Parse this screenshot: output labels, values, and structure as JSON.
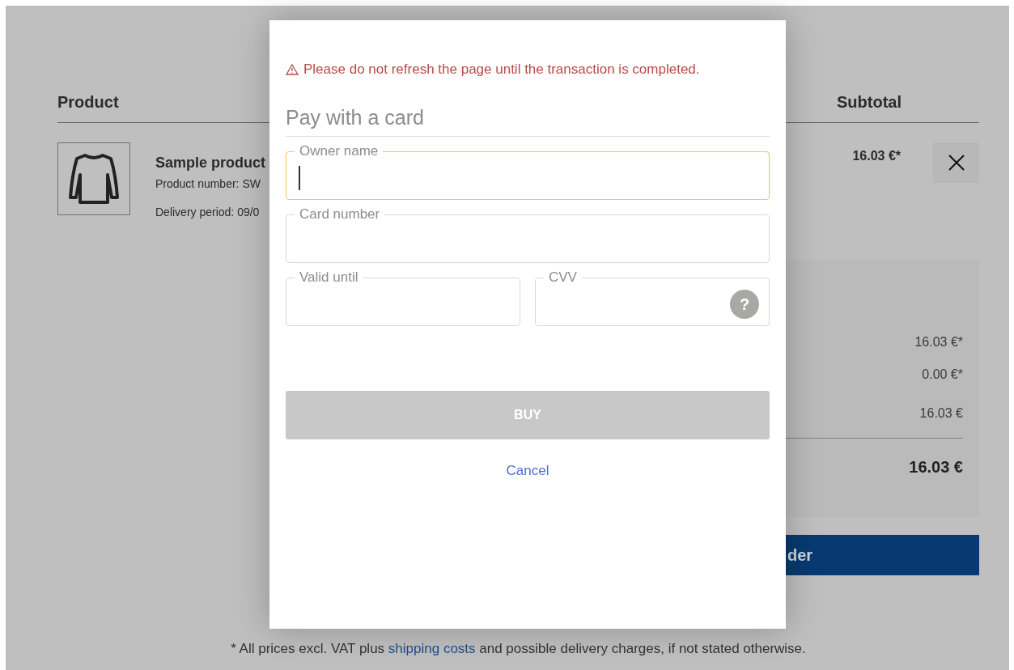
{
  "cart": {
    "columns": [
      "Product",
      "Subtotal"
    ],
    "item": {
      "name": "Sample product",
      "product_number": "Product number: SW",
      "delivery": "Delivery period: 09/0",
      "subtotal": "16.03 €*"
    },
    "summary": {
      "values": [
        "16.03 €*",
        "0.00 €*",
        "16.03 €"
      ],
      "total": "16.03 €"
    },
    "order_button": "der"
  },
  "footer": {
    "before": "* All prices excl. VAT plus ",
    "link": "shipping costs",
    "after": " and possible delivery charges, if not stated otherwise."
  },
  "modal": {
    "warning": "Please do not refresh the page until the transaction is completed.",
    "title": "Pay with a card",
    "fields": [
      {
        "label": "Owner name",
        "focused": true
      },
      {
        "label": "Card number",
        "focused": false
      }
    ],
    "half_fields": [
      {
        "label": "Valid until",
        "focused": false
      },
      {
        "label": "CVV",
        "focused": false,
        "help": "?"
      }
    ],
    "buy": {
      "label": "BUY",
      "disabled": true
    },
    "cancel": "Cancel"
  }
}
